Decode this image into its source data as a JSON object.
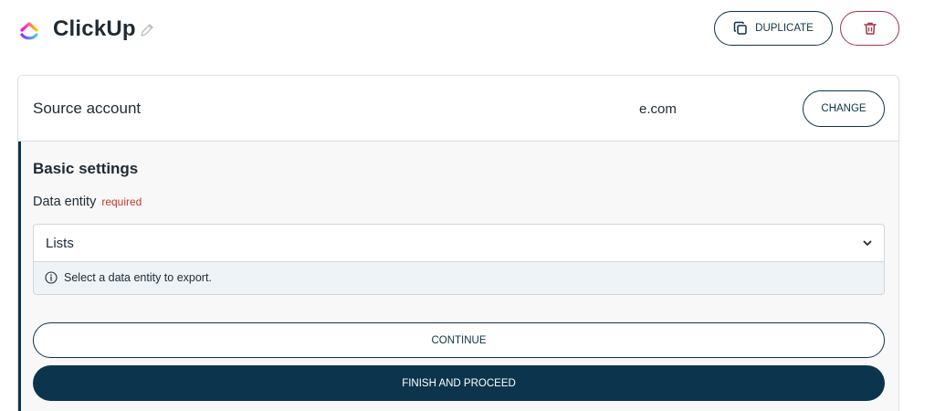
{
  "header": {
    "app_title": "ClickUp",
    "logo_icon": "clickup-logo-icon",
    "edit_icon": "pencil-icon",
    "duplicate_label": "DUPLICATE",
    "delete_icon": "trash-icon"
  },
  "source": {
    "label": "Source account",
    "account_email": "e.com",
    "change_label": "CHANGE"
  },
  "settings": {
    "title": "Basic settings",
    "field_label": "Data entity",
    "required_label": "required",
    "selected_value": "Lists",
    "hint": "Select a data entity to export."
  },
  "actions": {
    "continue_label": "CONTINUE",
    "finish_label": "FINISH AND PROCEED"
  },
  "colors": {
    "primary": "#0c354d",
    "danger": "#a7344a",
    "required": "#c0392b",
    "hint_bg": "#eef3f7"
  }
}
